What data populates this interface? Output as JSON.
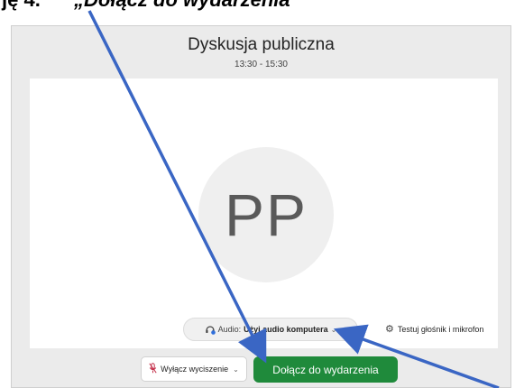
{
  "heading": {
    "prefix": "ję 4.",
    "text": "„Dołącz do wydarzenia"
  },
  "meeting": {
    "title": "Dyskusja publiczna",
    "time": "13:30 - 15:30"
  },
  "avatar": {
    "initials": "PP"
  },
  "audio": {
    "label": "Audio:",
    "value": "Użyj audio komputera",
    "icon": "headset-icon"
  },
  "test_link": {
    "label": "Testuj głośnik i mikrofon",
    "icon": "gear-icon"
  },
  "mute_button": {
    "label": "Wyłącz wyciszenie",
    "icon": "microphone-muted-icon"
  },
  "join_button": {
    "label": "Dołącz do wydarzenia"
  },
  "colors": {
    "join_green": "#1f8a3b",
    "arrow_blue": "#3a66c4",
    "window_bg": "#ebebeb"
  }
}
